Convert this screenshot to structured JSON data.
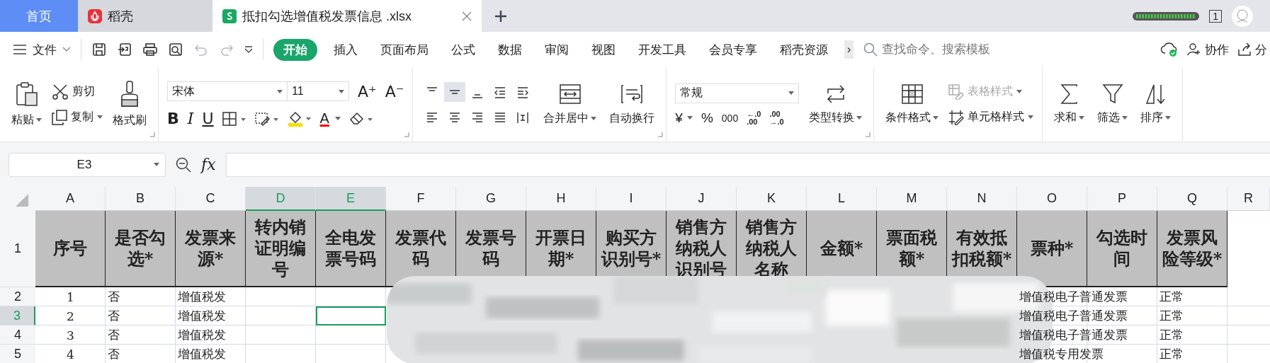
{
  "tabs": [
    {
      "label": "首页",
      "selected": false,
      "kind": "home"
    },
    {
      "label": "稻壳",
      "selected": false,
      "kind": "docer"
    },
    {
      "label": "抵扣勾选增值税发票信息 .xlsx",
      "selected": true,
      "kind": "sheet"
    }
  ],
  "window_count": "1",
  "menu": {
    "file": "文件",
    "quick_access": [
      {
        "disabled": false
      },
      {
        "disabled": false
      },
      {
        "disabled": false
      },
      {
        "disabled": false
      },
      {
        "disabled": true
      },
      {
        "disabled": true
      }
    ],
    "ribbon_tabs": [
      {
        "label": "开始",
        "selected": true
      },
      {
        "label": "插入",
        "selected": false
      },
      {
        "label": "页面布局",
        "selected": false
      },
      {
        "label": "公式",
        "selected": false
      },
      {
        "label": "数据",
        "selected": false
      },
      {
        "label": "审阅",
        "selected": false
      },
      {
        "label": "视图",
        "selected": false
      },
      {
        "label": "开发工具",
        "selected": false
      },
      {
        "label": "会员专享",
        "selected": false
      },
      {
        "label": "稻壳资源",
        "selected": false
      }
    ],
    "more": "›",
    "search": {
      "placeholder": "查找命令、搜索模板"
    },
    "actions": [
      {
        "label": "协作",
        "kind": "collab"
      },
      {
        "label": "分",
        "kind": "share"
      }
    ]
  },
  "ribbon": {
    "clipboard": {
      "paste": "粘贴",
      "cut": "剪切",
      "copy": "复制",
      "format_painter": "格式刷"
    },
    "font": {
      "name": "宋体",
      "size": "11",
      "grow": "A⁺",
      "shrink": "A⁻",
      "bold": "B",
      "italic": "I",
      "underline": "U",
      "font_color": "A"
    },
    "alignment": {
      "buttons": [
        {
          "selected": false
        },
        {
          "selected": true
        },
        {
          "selected": false
        },
        {
          "selected": false
        },
        {
          "selected": false
        },
        {
          "selected": false
        },
        {
          "selected": false
        },
        {
          "selected": false
        },
        {
          "selected": false
        },
        {
          "selected": false
        }
      ],
      "merge": "合并居中",
      "wrap": "自动换行"
    },
    "number": {
      "format": "常规",
      "currency": "¥",
      "percent": "%",
      "thousands": "000",
      "increase_decimal": [
        "←.0",
        ".00"
      ],
      "decrease_decimal": [
        ".00",
        "→.0"
      ],
      "convert": "类型转换"
    },
    "styles": {
      "conditional": "条件格式",
      "table_style": {
        "label": "表格样式",
        "disabled": true
      },
      "cell_style": {
        "label": "单元格样式",
        "disabled": false
      }
    },
    "editing": [
      "求和",
      "筛选",
      "排序"
    ]
  },
  "formula_bar": {
    "name_box": "E3",
    "fx": "fx"
  },
  "sheet": {
    "columns": [
      {
        "letter": "A",
        "selected": false,
        "active": false
      },
      {
        "letter": "B",
        "selected": false,
        "active": false
      },
      {
        "letter": "C",
        "selected": false,
        "active": false
      },
      {
        "letter": "D",
        "selected": true,
        "active": false
      },
      {
        "letter": "E",
        "selected": true,
        "active": true
      },
      {
        "letter": "F",
        "selected": false,
        "active": false
      },
      {
        "letter": "G",
        "selected": false,
        "active": false
      },
      {
        "letter": "H",
        "selected": false,
        "active": false
      },
      {
        "letter": "I",
        "selected": false,
        "active": false
      },
      {
        "letter": "J",
        "selected": false,
        "active": false
      },
      {
        "letter": "K",
        "selected": false,
        "active": false
      },
      {
        "letter": "L",
        "selected": false,
        "active": false
      },
      {
        "letter": "M",
        "selected": false,
        "active": false
      },
      {
        "letter": "N",
        "selected": false,
        "active": false
      },
      {
        "letter": "O",
        "selected": false,
        "active": false
      },
      {
        "letter": "P",
        "selected": false,
        "active": false
      },
      {
        "letter": "Q",
        "selected": false,
        "active": false
      },
      {
        "letter": "R",
        "selected": false,
        "active": false
      }
    ],
    "rows": [
      {
        "number": "1",
        "selected": false,
        "kind": "header",
        "cells": {
          "A": "序号",
          "B": "是否勾选*",
          "C": "发票来源*",
          "D": "转内销证明编号",
          "E": "全电发票号码",
          "F": "发票代码",
          "G": "发票号码",
          "H": "开票日期*",
          "I": "购买方识别号*",
          "J": "销售方纳税人识别号",
          "K": "销售方纳税人名称",
          "L": "金额*",
          "M": "票面税额*",
          "N": "有效抵扣税额*",
          "O": "票种*",
          "P": "勾选时间",
          "Q": "发票风险等级*"
        }
      },
      {
        "number": "2",
        "selected": false,
        "kind": "data",
        "cells": {
          "A": "1",
          "B": "否",
          "C": "增值税发",
          "O": "增值税电子普通发票",
          "Q": "正常"
        }
      },
      {
        "number": "3",
        "selected": true,
        "kind": "data",
        "cells": {
          "A": "2",
          "B": "否",
          "C": "增值税发",
          "O": "增值税电子普通发票",
          "Q": "正常"
        }
      },
      {
        "number": "4",
        "selected": false,
        "kind": "data",
        "cells": {
          "A": "3",
          "B": "否",
          "C": "增值税发",
          "O": "增值税电子普通发票",
          "Q": "正常"
        }
      },
      {
        "number": "5",
        "selected": false,
        "kind": "data",
        "cells": {
          "A": "4",
          "B": "否",
          "C": "增值税发",
          "O": "增值税专用发票",
          "Q": "正常"
        }
      }
    ]
  }
}
